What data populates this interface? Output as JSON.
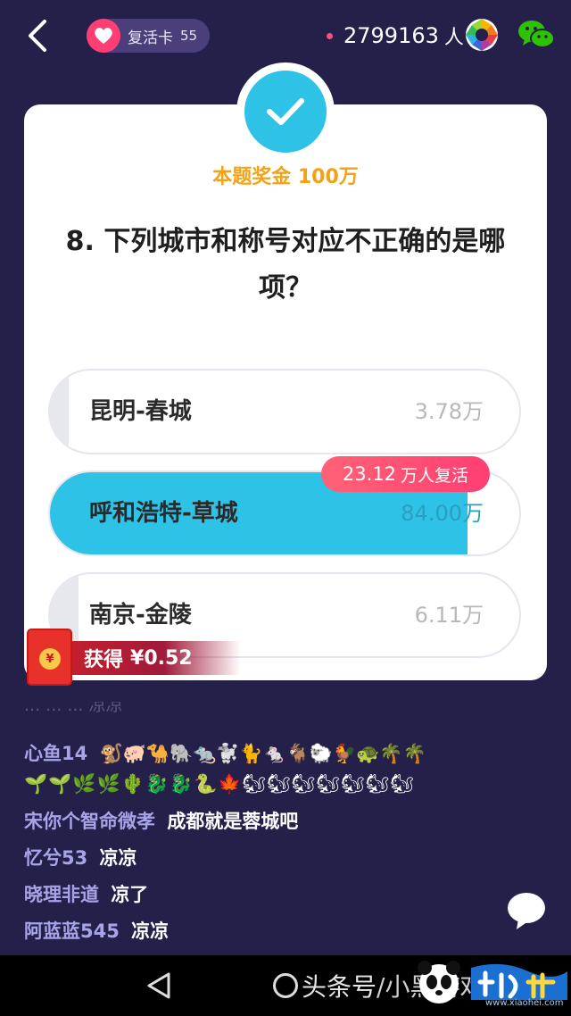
{
  "topbar": {
    "revive_card_label": "复活卡",
    "revive_card_count": "55",
    "online_count": "2799163",
    "online_unit": "人"
  },
  "card": {
    "prize_text": "本题奖金 100万",
    "question_text": "8. 下列城市和称号对应不正确的是哪项？",
    "options": [
      {
        "label": "昆明-春城",
        "count": "3.78万",
        "fill_fraction": 0.04
      },
      {
        "label": "呼和浩特-草城",
        "count": "84.00万",
        "fill_fraction": 0.89
      },
      {
        "label": "南京-金陵",
        "count": "6.11万",
        "fill_fraction": 0.06
      }
    ],
    "revive_tag_number": "23.12",
    "revive_tag_text": "万人复活"
  },
  "reward": {
    "coin_symbol": "¥",
    "label": "获得",
    "amount": "¥0.52"
  },
  "chat": {
    "faded_text": "... ... ... 凉凉",
    "lines": [
      {
        "user": "心鱼14",
        "msg": "🐒🐖🐪🐘🐀🐩🐈🐁🐐🐑🐓🐢🌴🌴"
      },
      {
        "user": "",
        "msg": "🌱🌱🌿🌿🌵🐉🐉🐍🍁🐿🐿🐿🐿🐿🐿🐿"
      },
      {
        "user": "宋你个智命微孝",
        "msg": "成都就是蓉城吧"
      },
      {
        "user": "忆兮53",
        "msg": "凉凉"
      },
      {
        "user": "晓理非道",
        "msg": "凉了"
      },
      {
        "user": "阿蓝蓝545",
        "msg": "凉凉"
      }
    ]
  },
  "navbar": {
    "watermark": "头条号",
    "watermark_tail": "/小黑游戏",
    "site": "www.xiaohei.com"
  },
  "colors": {
    "background": "#25204a",
    "accent_cyan": "#2ec2e6",
    "prize_orange": "#f2a218",
    "revive_pink": "#ff3f73"
  },
  "icons": [
    "back-icon",
    "heart-icon",
    "aperture-icon",
    "wechat-icon",
    "check-icon",
    "red-packet-icon",
    "chat-bubble-icon"
  ]
}
